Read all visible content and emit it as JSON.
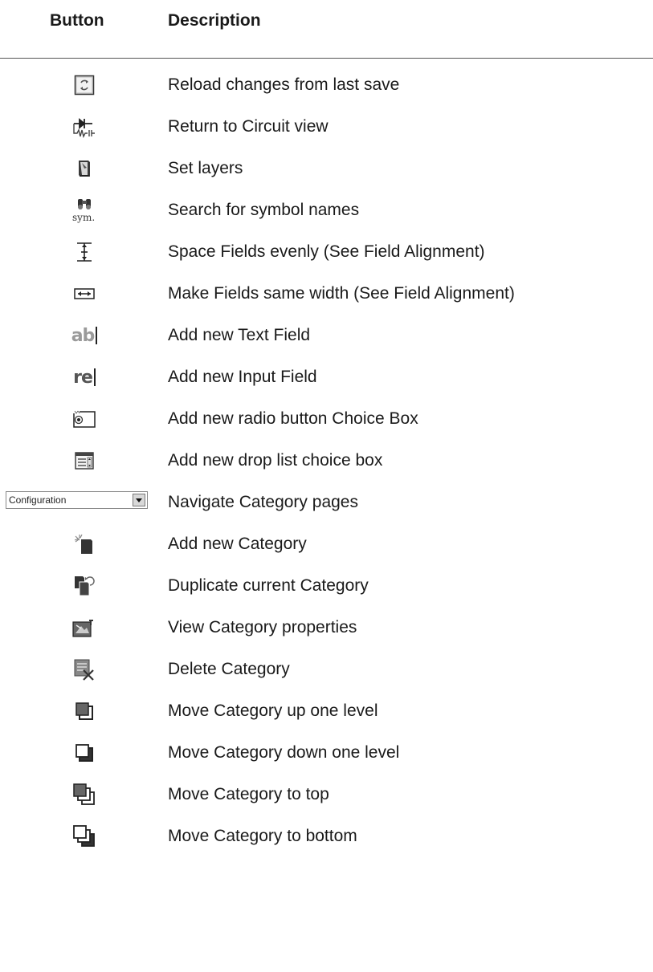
{
  "header": {
    "button_col": "Button",
    "description_col": "Description"
  },
  "rows": [
    {
      "icon": "reload-icon",
      "description": "Reload changes from last save"
    },
    {
      "icon": "circuit-view-icon",
      "description": "Return to Circuit view"
    },
    {
      "icon": "layers-icon",
      "description": "Set layers"
    },
    {
      "icon": "symbol-search-icon",
      "description": "Search for symbol names"
    },
    {
      "icon": "space-evenly-icon",
      "description": "Space Fields evenly (See Field Alignment)"
    },
    {
      "icon": "same-width-icon",
      "description": "Make Fields same width (See Field Alignment)"
    },
    {
      "icon": "text-field-icon",
      "icon_text": "ab",
      "description": "Add new Text Field"
    },
    {
      "icon": "input-field-icon",
      "icon_text": "re",
      "description": "Add new Input Field"
    },
    {
      "icon": "radio-choice-icon",
      "description": "Add new radio button Choice Box"
    },
    {
      "icon": "drop-list-icon",
      "description": "Add new drop list choice box"
    },
    {
      "icon": "category-dropdown",
      "dropdown_value": "Configuration",
      "description": "Navigate Category pages"
    },
    {
      "icon": "new-category-icon",
      "description": "Add new Category"
    },
    {
      "icon": "duplicate-category-icon",
      "description": "Duplicate current Category"
    },
    {
      "icon": "category-properties-icon",
      "description": "View Category properties"
    },
    {
      "icon": "delete-category-icon",
      "description": "Delete Category"
    },
    {
      "icon": "move-up-icon",
      "description": "Move Category up one level"
    },
    {
      "icon": "move-down-icon",
      "description": "Move Category down one level"
    },
    {
      "icon": "move-top-icon",
      "description": "Move Category to top"
    },
    {
      "icon": "move-bottom-icon",
      "description": "Move Category to bottom"
    }
  ]
}
